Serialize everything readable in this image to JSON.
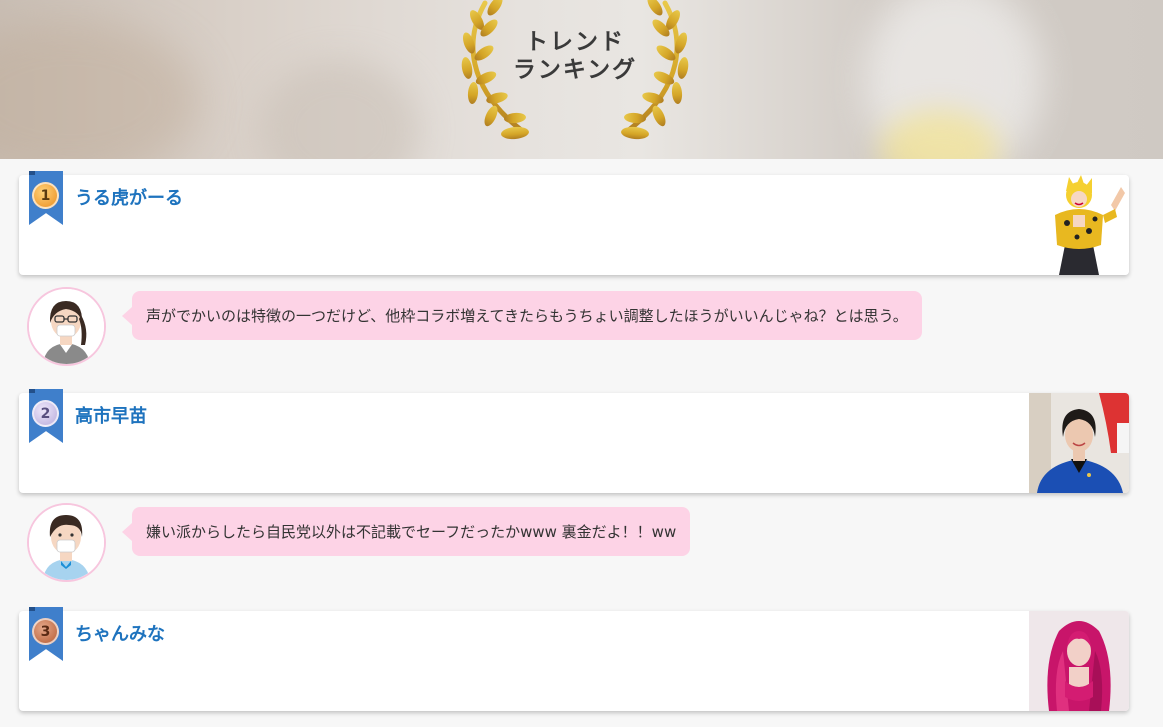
{
  "header": {
    "title_line1": "トレンド",
    "title_line2": "ランキング"
  },
  "rankings": [
    {
      "rank": "1",
      "name": "うる虎がーる"
    },
    {
      "rank": "2",
      "name": "高市早苗"
    },
    {
      "rank": "3",
      "name": "ちゃんみな"
    }
  ],
  "comments": [
    {
      "text": "声がでかいのは特徴の一つだけど、他枠コラボ増えてきたらもうちょい調整したほうがいいんじゃね？とは思う。"
    },
    {
      "text": "嫌い派からしたら自民党以外は不記載でセーフだったかwww 裏金だよ！！ww"
    }
  ],
  "colors": {
    "accent": "#1e73be",
    "ribbon": "#3f7fcb",
    "bubble": "#fdd3e6",
    "avatar_border": "#f7c6de"
  },
  "icons": {
    "header": "laurel-wreath-icon",
    "rank_badge": "ribbon-medal-icon"
  }
}
